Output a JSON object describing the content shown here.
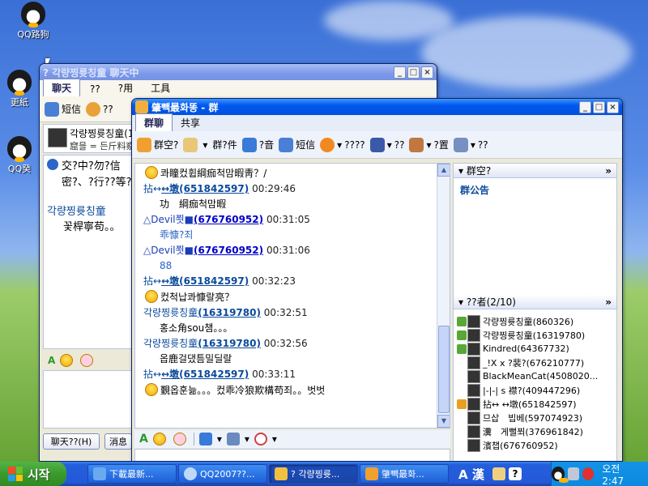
{
  "desktop": {
    "icons": [
      {
        "label": "QQ路狗"
      },
      {
        "label": "更紙"
      },
      {
        "label": "QQ癸"
      }
    ]
  },
  "back_window": {
    "title": "? 각량찡륫칭童 聊天中",
    "menu": [
      "聊天",
      "??",
      "?用",
      "工具"
    ],
    "toolbar": {
      "msg_label": "短信",
      "more_label": "??"
    },
    "contact": {
      "name": "각량찡륫칭童(1",
      "sign": "窟믈 = 든斤料察"
    },
    "notice": "交?中?勿?信 密?、?行??等?",
    "messages": [
      {
        "name": "각량찡륫칭童",
        "text": "꽃桿寧苟。。"
      }
    ],
    "buttons": {
      "chat_history": "聊天??(H)",
      "message": "消息"
    }
  },
  "group_window": {
    "title": "肇빽最화똥 - 群",
    "tabs": [
      "群聊",
      "共享"
    ],
    "toolbar": [
      {
        "label": "群空?"
      },
      {
        "label": ""
      },
      {
        "label": "群?件"
      },
      {
        "label": "?音"
      },
      {
        "label": "短信"
      },
      {
        "label": "????"
      },
      {
        "label": "??"
      },
      {
        "label": "?置"
      },
      {
        "label": "??"
      }
    ],
    "messages": [
      {
        "kind": "text",
        "emo": true,
        "text": "콰瞳컸휩綱痂척맘暇靑？/"
      },
      {
        "kind": "header",
        "prefix": "拈↔",
        "link": "↔墩(651842597)",
        "time": "00:29:46"
      },
      {
        "kind": "text",
        "emo": false,
        "text": "功　綱痂척맘暇"
      },
      {
        "kind": "header",
        "prefix": "△Devil쬣■",
        "link": "(676760952)",
        "time": "00:31:05"
      },
      {
        "kind": "text",
        "emo": false,
        "text": "乖慷?죄",
        "color": "#2a63c6"
      },
      {
        "kind": "header",
        "prefix": "△Devil쬣■",
        "link": "(676760952)",
        "time": "00:31:06"
      },
      {
        "kind": "text",
        "emo": false,
        "text": "88",
        "color": "#2a63c6"
      },
      {
        "kind": "header",
        "prefix": "拈↔",
        "link": "↔墩(651842597)",
        "time": "00:32:23"
      },
      {
        "kind": "text",
        "emo": true,
        "text": "컸척납콰慷랄亮？"
      },
      {
        "kind": "header",
        "prefix": "각량찡륫칭童",
        "link": "(16319780)",
        "time": "00:32:51"
      },
      {
        "kind": "text",
        "emo": false,
        "text": "홍소角sou챔。。。"
      },
      {
        "kind": "header",
        "prefix": "각량찡륫칭童",
        "link": "(16319780)",
        "time": "00:32:56"
      },
      {
        "kind": "text",
        "emo": false,
        "text": "옵鹿걸댔틈밀딜랄"
      },
      {
        "kind": "header",
        "prefix": "拈↔",
        "link": "↔墩(651842597)",
        "time": "00:33:11"
      },
      {
        "kind": "text",
        "emo": true,
        "text": "覲옵훈늚。。。컸乖冷狼欺構苟죄。。벗벗"
      }
    ],
    "side": {
      "space_title": "群空?",
      "announcement": "群公告",
      "members_title": "??者(2/10)",
      "members": [
        {
          "name": "각량찡륫칭童(860326)"
        },
        {
          "name": "각량찡륫칭童(16319780)"
        },
        {
          "name": "Kindred(64367732)"
        },
        {
          "name": "_!X x ?裴?(676210777)"
        },
        {
          "name": "BlackMeanCat(4508020..."
        },
        {
          "name": "|-|-| s  襟?(409447296)"
        },
        {
          "name": "拈↔  ↔墩(651842597)"
        },
        {
          "name": "므삽　빕베(597074923)"
        },
        {
          "name": "瀵　게뻘쬐(376961842)"
        },
        {
          "name": "濱챕(676760952)"
        }
      ]
    }
  },
  "taskbar": {
    "start_label": "시작",
    "tasks": [
      {
        "label": "下載最新..."
      },
      {
        "label": "QQ2007??..."
      },
      {
        "label": "? 각량찡륫..."
      },
      {
        "label": "肇빽最화..."
      }
    ],
    "ime": "A 漢",
    "clock": "오전 2:47"
  }
}
